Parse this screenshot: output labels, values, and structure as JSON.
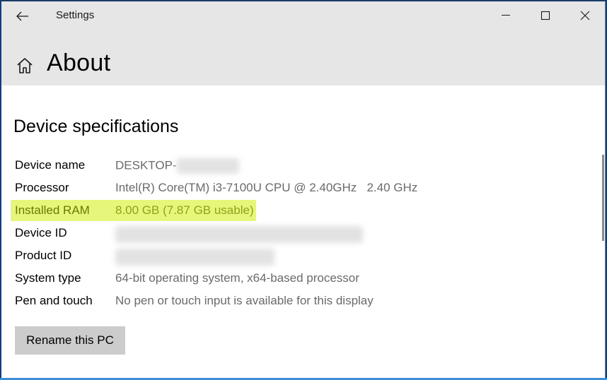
{
  "window": {
    "app_title": "Settings",
    "controls": {
      "minimize_icon": "minimize-icon",
      "maximize_icon": "maximize-icon",
      "close_icon": "close-icon"
    }
  },
  "header": {
    "back_icon": "back-arrow-icon",
    "home_icon": "home-icon",
    "page_title": "About"
  },
  "device_specs": {
    "section_title": "Device specifications",
    "rows": [
      {
        "label": "Device name",
        "value": "DESKTOP-",
        "redacted": true
      },
      {
        "label": "Processor",
        "value": "Intel(R) Core(TM) i3-7100U CPU @ 2.40GHz   2.40 GHz"
      },
      {
        "label": "Installed RAM",
        "value": "8.00 GB (7.87 GB usable)",
        "highlighted": true
      },
      {
        "label": "Device ID",
        "value": "",
        "redacted": true
      },
      {
        "label": "Product ID",
        "value": "",
        "redacted": true
      },
      {
        "label": "System type",
        "value": "64-bit operating system, x64-based processor"
      },
      {
        "label": "Pen and touch",
        "value": "No pen or touch input is available for this display"
      }
    ]
  },
  "actions": {
    "rename_label": "Rename this PC"
  },
  "colors": {
    "header_bg": "#e6e6e6",
    "highlight": "#e6f67a",
    "button_bg": "#cccccc"
  }
}
